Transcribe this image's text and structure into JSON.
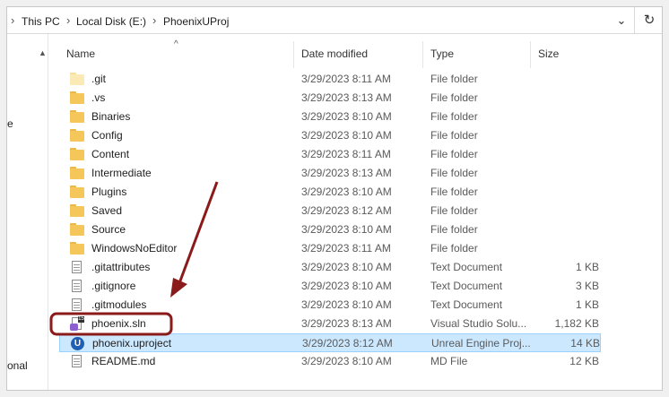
{
  "breadcrumb": {
    "items": [
      "This PC",
      "Local Disk (E:)",
      "PhoenixUProj"
    ],
    "separator": "›",
    "dropdown_icon": "chevron-down-icon",
    "refresh_icon": "refresh-icon"
  },
  "nav": {
    "fragments": [
      "e",
      "onal"
    ]
  },
  "columns": {
    "name": "Name",
    "date": "Date modified",
    "type": "Type",
    "size": "Size",
    "sort_indicator": "^"
  },
  "files": [
    {
      "name": ".git",
      "date": "3/29/2023 8:11 AM",
      "type": "File folder",
      "size": "",
      "icon": "folder-icon-hidden"
    },
    {
      "name": ".vs",
      "date": "3/29/2023 8:13 AM",
      "type": "File folder",
      "size": "",
      "icon": "folder-icon"
    },
    {
      "name": "Binaries",
      "date": "3/29/2023 8:10 AM",
      "type": "File folder",
      "size": "",
      "icon": "folder-icon"
    },
    {
      "name": "Config",
      "date": "3/29/2023 8:10 AM",
      "type": "File folder",
      "size": "",
      "icon": "folder-icon"
    },
    {
      "name": "Content",
      "date": "3/29/2023 8:11 AM",
      "type": "File folder",
      "size": "",
      "icon": "folder-icon"
    },
    {
      "name": "Intermediate",
      "date": "3/29/2023 8:13 AM",
      "type": "File folder",
      "size": "",
      "icon": "folder-icon"
    },
    {
      "name": "Plugins",
      "date": "3/29/2023 8:10 AM",
      "type": "File folder",
      "size": "",
      "icon": "folder-icon"
    },
    {
      "name": "Saved",
      "date": "3/29/2023 8:12 AM",
      "type": "File folder",
      "size": "",
      "icon": "folder-icon"
    },
    {
      "name": "Source",
      "date": "3/29/2023 8:10 AM",
      "type": "File folder",
      "size": "",
      "icon": "folder-icon"
    },
    {
      "name": "WindowsNoEditor",
      "date": "3/29/2023 8:11 AM",
      "type": "File folder",
      "size": "",
      "icon": "folder-icon"
    },
    {
      "name": ".gitattributes",
      "date": "3/29/2023 8:10 AM",
      "type": "Text Document",
      "size": "1 KB",
      "icon": "text-document-icon"
    },
    {
      "name": ".gitignore",
      "date": "3/29/2023 8:10 AM",
      "type": "Text Document",
      "size": "3 KB",
      "icon": "text-document-icon"
    },
    {
      "name": ".gitmodules",
      "date": "3/29/2023 8:10 AM",
      "type": "Text Document",
      "size": "1 KB",
      "icon": "text-document-icon"
    },
    {
      "name": "phoenix.sln",
      "date": "3/29/2023 8:13 AM",
      "type": "Visual Studio Solu...",
      "size": "1,182 KB",
      "icon": "visual-studio-solution-icon"
    },
    {
      "name": "phoenix.uproject",
      "date": "3/29/2023 8:12 AM",
      "type": "Unreal Engine Proj...",
      "size": "14 KB",
      "icon": "unreal-engine-icon",
      "selected": true
    },
    {
      "name": "README.md",
      "date": "3/29/2023 8:10 AM",
      "type": "MD File",
      "size": "12 KB",
      "icon": "text-document-icon"
    }
  ],
  "colors": {
    "selection_bg": "#cce8ff",
    "annotation": "#8b1a1a"
  }
}
